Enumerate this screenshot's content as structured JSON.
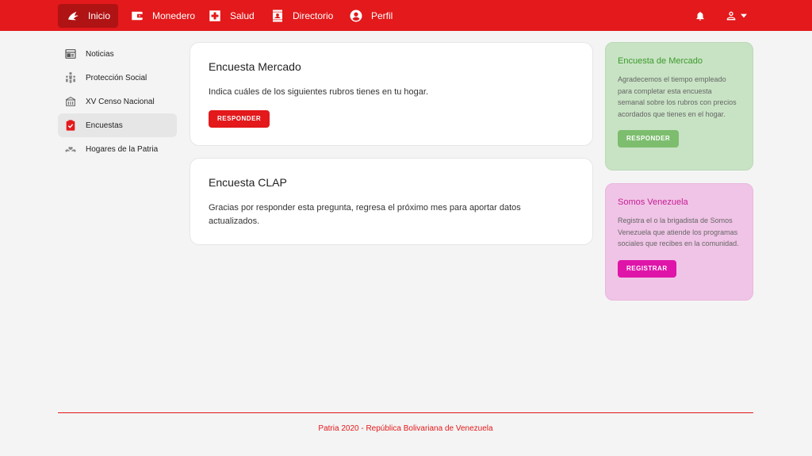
{
  "nav": {
    "items": [
      {
        "label": "Inicio",
        "icon": "patria-logo-icon"
      },
      {
        "label": "Monedero",
        "icon": "wallet-icon"
      },
      {
        "label": "Salud",
        "icon": "health-cross-icon"
      },
      {
        "label": "Directorio",
        "icon": "contact-book-icon"
      },
      {
        "label": "Perfil",
        "icon": "user-circle-icon"
      }
    ],
    "active": "Inicio"
  },
  "sidebar": {
    "items": [
      {
        "label": "Noticias",
        "icon": "news-icon"
      },
      {
        "label": "Protección Social",
        "icon": "family-icon"
      },
      {
        "label": "XV Censo Nacional",
        "icon": "census-building-icon"
      },
      {
        "label": "Encuestas",
        "icon": "clipboard-check-icon"
      },
      {
        "label": "Hogares de la Patria",
        "icon": "heart-hands-icon"
      }
    ],
    "active": "Encuestas"
  },
  "cards": [
    {
      "title": "Encuesta Mercado",
      "text": "Indica cuáles de los siguientes rubros tienes en tu hogar.",
      "button": "RESPONDER"
    },
    {
      "title": "Encuesta CLAP",
      "text": "Gracias por responder esta pregunta, regresa el próximo mes para aportar datos actualizados."
    }
  ],
  "promos": [
    {
      "title": "Encuesta de Mercado",
      "text": "Agradecemos el tiempo empleado para completar esta encuesta semanal sobre los rubros con precios acordados que tienes en el hogar.",
      "button": "RESPONDER"
    },
    {
      "title": "Somos Venezuela",
      "text": "Registra el o la brigadista de Somos Venezuela que atiende los programas sociales que recibes en la comunidad.",
      "button": "REGISTRAR"
    }
  ],
  "footer": {
    "text": "Patria 2020 - República Bolivariana de Venezuela"
  },
  "colors": {
    "brand_red": "#e3191b",
    "green_accent": "#7dbd6e",
    "pink_accent": "#df14a9"
  }
}
